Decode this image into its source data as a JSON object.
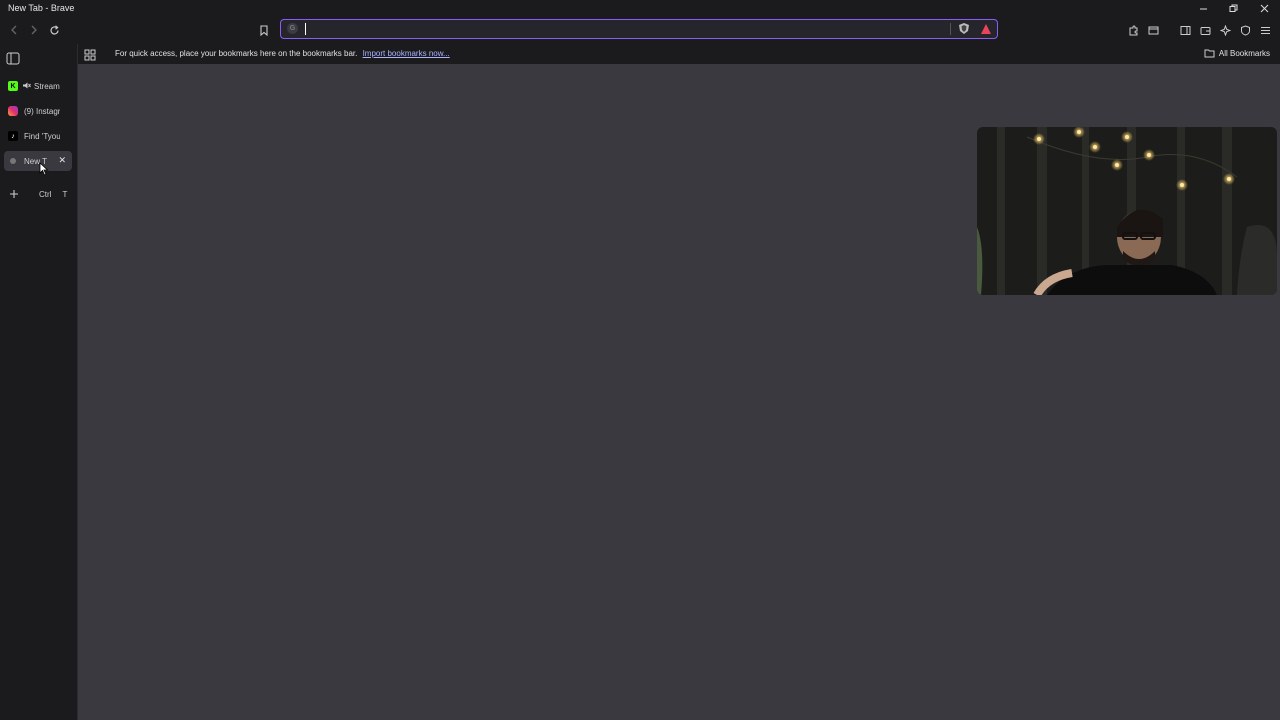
{
  "window": {
    "title": "New Tab - Brave"
  },
  "toolbar": {
    "address_value": "",
    "address_placeholder": ""
  },
  "bookmarks_bar": {
    "message": "For quick access, place your bookmarks here on the bookmarks bar.",
    "import_link": "Import bookmarks now...",
    "all_bookmarks": "All Bookmarks"
  },
  "sidebar": {
    "tabs": [
      {
        "label": "Stream",
        "icon": "kick-icon",
        "muted": true
      },
      {
        "label": "(9) Instagra",
        "icon": "instagram-icon"
      },
      {
        "label": "Find 'Tyou",
        "icon": "tiktok-icon"
      },
      {
        "label": "New T",
        "icon": "new-tab-icon",
        "active": true
      }
    ],
    "new_tab_shortcut": {
      "ctrl": "Ctrl",
      "key": "T"
    }
  },
  "colors": {
    "accent": "#8b5cf6",
    "background": "#3a393f",
    "chrome": "#1b1b1e"
  }
}
